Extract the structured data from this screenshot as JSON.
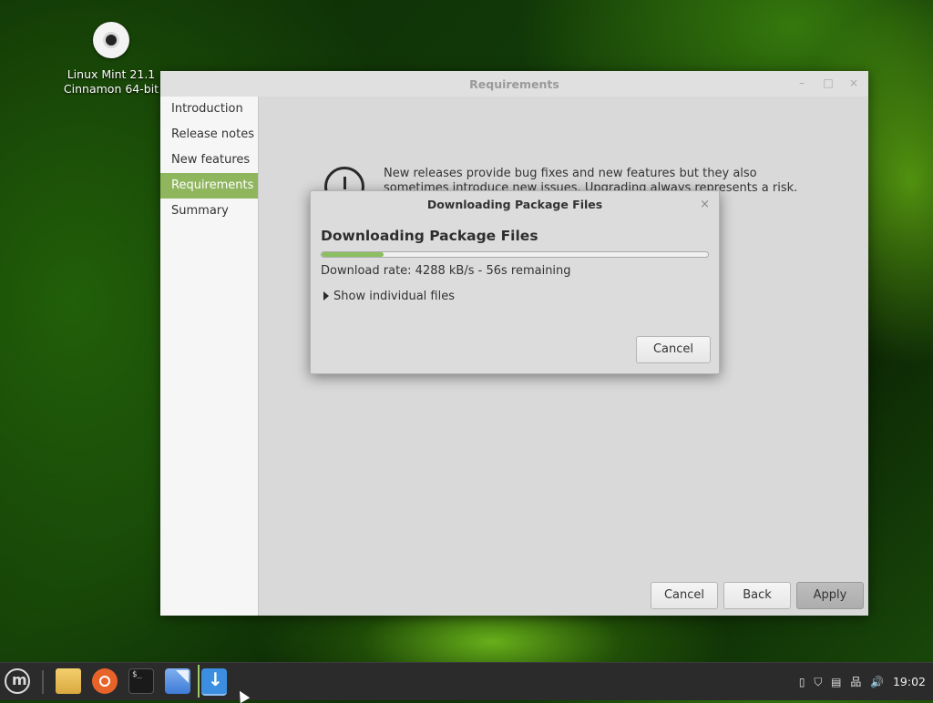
{
  "desktop": {
    "icon_label_line1": "Linux Mint 21.1",
    "icon_label_line2": "Cinnamon 64-bit"
  },
  "window": {
    "title": "Requirements",
    "controls": {
      "minimize": "–",
      "maximize": "□",
      "close": "×"
    },
    "sidebar": {
      "items": [
        {
          "label": "Introduction"
        },
        {
          "label": "Release notes"
        },
        {
          "label": "New features"
        },
        {
          "label": "Requirements"
        },
        {
          "label": "Summary"
        }
      ],
      "active_index": 3
    },
    "info_text": "New releases provide bug fixes and new features but they also sometimes introduce new issues. Upgrading always represents a risk. Your data is safe",
    "buttons": {
      "cancel": "Cancel",
      "back": "Back",
      "apply": "Apply"
    }
  },
  "dialog": {
    "title": "Downloading Package Files",
    "close": "×",
    "heading": "Downloading Package Files",
    "progress_fraction": 0.16,
    "rate_text": "Download rate: 4288 kB/s - 56s remaining",
    "expander_label": "Show individual files",
    "cancel_label": "Cancel"
  },
  "taskbar": {
    "launchers": [
      "menu-icon",
      "folder-icon",
      "firefox-icon",
      "terminal-icon",
      "update-manager-icon",
      "download-icon"
    ],
    "tray": {
      "icons": [
        "notification-icon",
        "shield-icon",
        "clipboard-icon",
        "network-icon",
        "volume-icon"
      ],
      "glyphs": {
        "notification": "▯",
        "shield": "⛉",
        "clipboard": "▤",
        "network": "品",
        "volume": "🔊"
      }
    },
    "clock": "19:02"
  }
}
